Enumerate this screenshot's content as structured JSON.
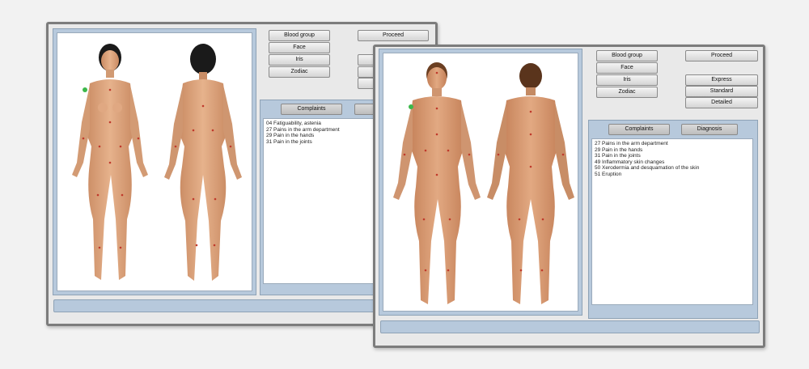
{
  "female_window": {
    "buttons": {
      "blood_group": "Blood group",
      "face": "Face",
      "iris": "Iris",
      "zodiac": "Zodiac",
      "proceed": "Proceed",
      "complaints": "Complaints",
      "diagnosis_partial": "D"
    },
    "complaints": [
      "04 Fatiguability, astenia",
      "27 Pains in the arm department",
      "29 Pain in the hands",
      "31 Pain in the joints"
    ]
  },
  "male_window": {
    "buttons": {
      "blood_group": "Blood group",
      "face": "Face",
      "iris": "Iris",
      "zodiac": "Zodiac",
      "proceed": "Proceed",
      "express": "Express",
      "standard": "Standard",
      "detailed": "Detailed",
      "complaints": "Complaints",
      "diagnosis": "Diagnosis"
    },
    "complaints": [
      "27 Pains in the arm department",
      "29 Pain in the hands",
      "31 Pain in the joints",
      "49 Inflammatory skin changes",
      "50 Xerodermia and desquamation of the skin",
      "51 Eruption"
    ]
  },
  "colors": {
    "panel_blue": "#b7c9dc",
    "skin": "#d9a07a",
    "point_red": "#c0392b",
    "point_green": "#3cb84a"
  }
}
